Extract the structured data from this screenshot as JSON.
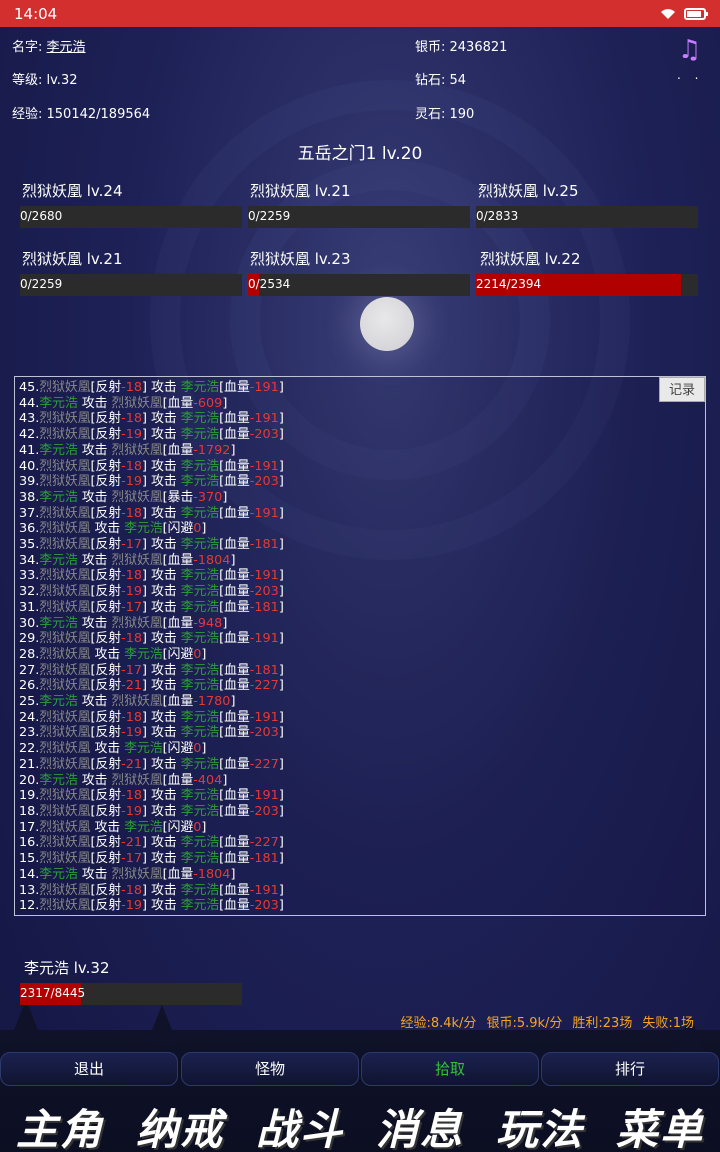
{
  "status_bar": {
    "time": "14:04",
    "wifi_icon": "wifi-icon",
    "battery_icon": "battery-icon"
  },
  "player_info": {
    "name_label": "名字: ",
    "name_value": "李元浩",
    "level_label": "等级: ",
    "level_value": "lv.32",
    "exp_label": "经验: ",
    "exp_value": "150142/189564",
    "silver_label": "银币: ",
    "silver_value": "2436821",
    "diamond_label": "钻石: ",
    "diamond_value": "54",
    "spirit_label": "灵石: ",
    "spirit_value": "190"
  },
  "top_icons": {
    "music": "♫",
    "dots": ". ."
  },
  "stage_title": "五岳之门1 lv.20",
  "enemies": [
    {
      "name": "烈狱妖凰 lv.24",
      "hp_text": "0/2680",
      "hp_fraction": 0
    },
    {
      "name": "烈狱妖凰 lv.21",
      "hp_text": "0/2259",
      "hp_fraction": 0
    },
    {
      "name": "烈狱妖凰 lv.25",
      "hp_text": "0/2833",
      "hp_fraction": 0
    },
    {
      "name": "烈狱妖凰 lv.21",
      "hp_text": "0/2259",
      "hp_fraction": 0
    },
    {
      "name": "烈狱妖凰 lv.23",
      "hp_text": "0/2534",
      "hp_fraction": 0.05
    },
    {
      "name": "烈狱妖凰 lv.22",
      "hp_text": "2214/2394",
      "hp_fraction": 0.925
    }
  ],
  "log": {
    "record_button": "记录",
    "monster": "烈狱妖凰",
    "player": "李元浩",
    "entries": [
      {
        "n": "45.",
        "kind": "reflect",
        "r": "-18",
        "tag": "血量",
        "v": "-191"
      },
      {
        "n": "44.",
        "kind": "pattack",
        "tag": "血量",
        "v": "-609"
      },
      {
        "n": "43.",
        "kind": "reflect",
        "r": "-18",
        "tag": "血量",
        "v": "-191"
      },
      {
        "n": "42.",
        "kind": "reflect",
        "r": "-19",
        "tag": "血量",
        "v": "-203"
      },
      {
        "n": "41.",
        "kind": "pattack",
        "tag": "血量",
        "v": "-1792"
      },
      {
        "n": "40.",
        "kind": "reflect",
        "r": "-18",
        "tag": "血量",
        "v": "-191"
      },
      {
        "n": "39.",
        "kind": "reflect",
        "r": "-19",
        "tag": "血量",
        "v": "-203"
      },
      {
        "n": "38.",
        "kind": "pattack",
        "tag": "暴击",
        "v": "-370"
      },
      {
        "n": "37.",
        "kind": "reflect",
        "r": "-18",
        "tag": "血量",
        "v": "-191"
      },
      {
        "n": "36.",
        "kind": "mattack",
        "tag": "闪避",
        "v": "0"
      },
      {
        "n": "35.",
        "kind": "reflect",
        "r": "-17",
        "tag": "血量",
        "v": "-181"
      },
      {
        "n": "34.",
        "kind": "pattack",
        "tag": "血量",
        "v": "-1804"
      },
      {
        "n": "33.",
        "kind": "reflect",
        "r": "-18",
        "tag": "血量",
        "v": "-191"
      },
      {
        "n": "32.",
        "kind": "reflect",
        "r": "-19",
        "tag": "血量",
        "v": "-203"
      },
      {
        "n": "31.",
        "kind": "reflect",
        "r": "-17",
        "tag": "血量",
        "v": "-181"
      },
      {
        "n": "30.",
        "kind": "pattack",
        "tag": "血量",
        "v": "-948"
      },
      {
        "n": "29.",
        "kind": "reflect",
        "r": "-18",
        "tag": "血量",
        "v": "-191"
      },
      {
        "n": "28.",
        "kind": "mattack",
        "tag": "闪避",
        "v": "0"
      },
      {
        "n": "27.",
        "kind": "reflect",
        "r": "-17",
        "tag": "血量",
        "v": "-181"
      },
      {
        "n": "26.",
        "kind": "reflect",
        "r": "-21",
        "tag": "血量",
        "v": "-227"
      },
      {
        "n": "25.",
        "kind": "pattack",
        "tag": "血量",
        "v": "-1780"
      },
      {
        "n": "24.",
        "kind": "reflect",
        "r": "-18",
        "tag": "血量",
        "v": "-191"
      },
      {
        "n": "23.",
        "kind": "reflect",
        "r": "-19",
        "tag": "血量",
        "v": "-203"
      },
      {
        "n": "22.",
        "kind": "mattack",
        "tag": "闪避",
        "v": "0"
      },
      {
        "n": "21.",
        "kind": "reflect",
        "r": "-21",
        "tag": "血量",
        "v": "-227"
      },
      {
        "n": "20.",
        "kind": "pattack",
        "tag": "血量",
        "v": "-404"
      },
      {
        "n": "19.",
        "kind": "reflect",
        "r": "-18",
        "tag": "血量",
        "v": "-191"
      },
      {
        "n": "18.",
        "kind": "reflect",
        "r": "-19",
        "tag": "血量",
        "v": "-203"
      },
      {
        "n": "17.",
        "kind": "mattack",
        "tag": "闪避",
        "v": "0"
      },
      {
        "n": "16.",
        "kind": "reflect",
        "r": "-21",
        "tag": "血量",
        "v": "-227"
      },
      {
        "n": "15.",
        "kind": "reflect",
        "r": "-17",
        "tag": "血量",
        "v": "-181"
      },
      {
        "n": "14.",
        "kind": "pattack",
        "tag": "血量",
        "v": "-1804"
      },
      {
        "n": "13.",
        "kind": "reflect",
        "r": "-18",
        "tag": "血量",
        "v": "-191"
      },
      {
        "n": "12.",
        "kind": "reflect",
        "r": "-19",
        "tag": "血量",
        "v": "-203"
      }
    ]
  },
  "player_status": {
    "name": "李元浩 lv.32",
    "hp_text": "2317/8445",
    "hp_fraction": 0.274
  },
  "stats": {
    "exp_rate": "经验:8.4k/分",
    "silver_rate": "银币:5.9k/分",
    "wins": "胜利:23场",
    "losses": "失败:1场"
  },
  "actions": {
    "exit": "退出",
    "monsters": "怪物",
    "pickup": "拾取",
    "ranking": "排行"
  },
  "menu": {
    "hero": "主角",
    "storage": "纳戒",
    "battle": "战斗",
    "messages": "消息",
    "gameplay": "玩法",
    "menu": "菜单"
  },
  "colors": {
    "status_bar": "#d32f2f",
    "hp_fill": "#b00000",
    "player_green": "#2e9e3a",
    "damage_red": "#e53935",
    "stats_orange": "#f7a51d",
    "pickup_green": "#35c03a"
  }
}
